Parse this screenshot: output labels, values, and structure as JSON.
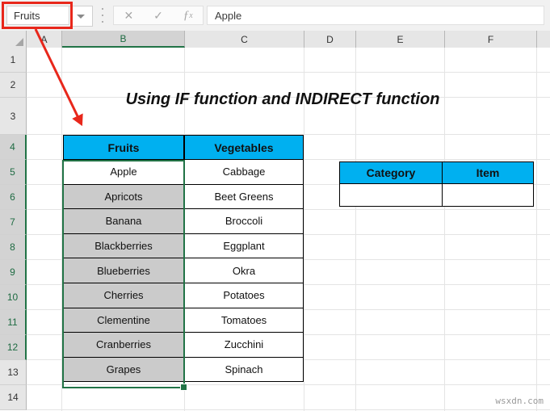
{
  "formula_bar": {
    "name_box_value": "Fruits",
    "formula_value": "Apple",
    "cancel_icon": "close-icon",
    "confirm_icon": "check-icon",
    "function_icon": "fx-icon",
    "dropdown_icon": "chevron-down-icon",
    "menu_icon": "kebab-menu-icon"
  },
  "grid": {
    "columns": [
      "A",
      "B",
      "C",
      "D",
      "E",
      "F"
    ],
    "selected_column": "B",
    "rows": [
      "1",
      "2",
      "3",
      "4",
      "5",
      "6",
      "7",
      "8",
      "9",
      "10",
      "11",
      "12",
      "13",
      "14"
    ],
    "selected_rows": [
      "4",
      "5",
      "6",
      "7",
      "8",
      "9",
      "10",
      "11",
      "12"
    ]
  },
  "title": "Using IF function and INDIRECT function",
  "data_table": {
    "headers": [
      "Fruits",
      "Vegetables"
    ],
    "fruits": [
      "Apple",
      "Apricots",
      "Banana",
      "Blackberries",
      "Blueberries",
      "Cherries",
      "Clementine",
      "Cranberries",
      "Grapes"
    ],
    "vegetables": [
      "Cabbage",
      "Beet Greens",
      "Broccoli",
      "Eggplant",
      "Okra",
      "Potatoes",
      "Tomatoes",
      "Zucchini",
      "Spinach"
    ]
  },
  "lookup_table": {
    "headers": [
      "Category",
      "Item"
    ],
    "values": [
      "",
      ""
    ]
  },
  "colors": {
    "header_fill": "#00b0f0",
    "selection_green": "#217346",
    "annotation_red": "#e8271b",
    "selection_gray": "#cbcbcb"
  },
  "watermark": "wsxdn.com"
}
